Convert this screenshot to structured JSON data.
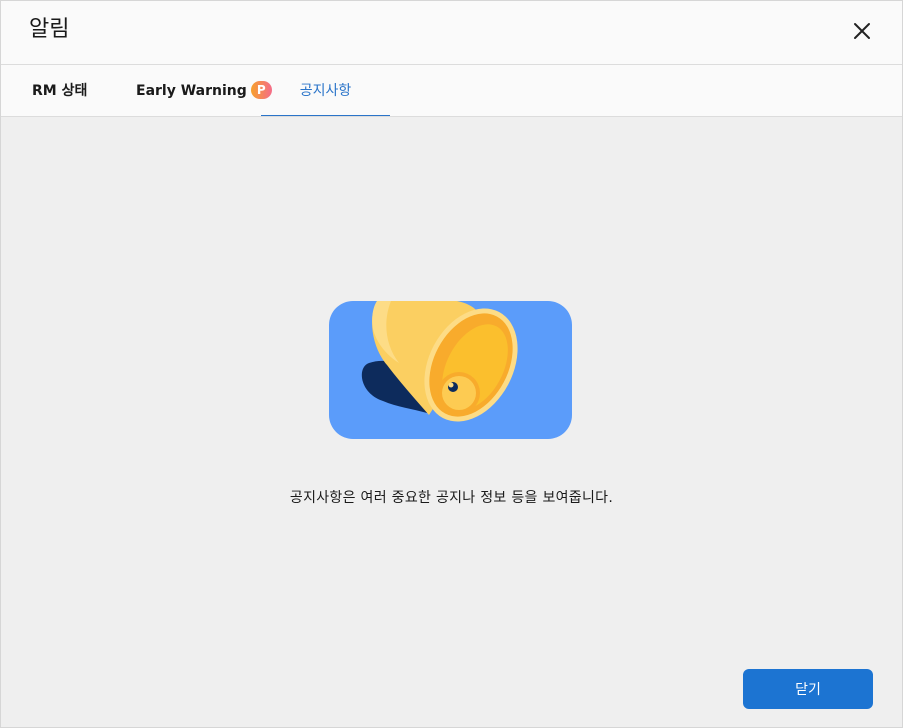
{
  "dialog": {
    "title": "알림",
    "close_icon": "close-icon"
  },
  "tabs": [
    {
      "label": "RM 상태",
      "active": false
    },
    {
      "label": "Early Warning",
      "badge": "P",
      "active": false
    },
    {
      "label": "공지사항",
      "active": true
    }
  ],
  "content": {
    "illustration": "bell-icon",
    "message": "공지사항은 여러 중요한 공지나 정보 등을 보여줍니다."
  },
  "footer": {
    "close_label": "닫기"
  },
  "colors": {
    "accent": "#1c74d2",
    "active_tab": "#2a74c9",
    "illustration_bg": "#5b9cfa",
    "bell_gold": "#fbbf2d",
    "badge_gradient_start": "#f7a02c",
    "badge_gradient_end": "#f46c8a"
  }
}
